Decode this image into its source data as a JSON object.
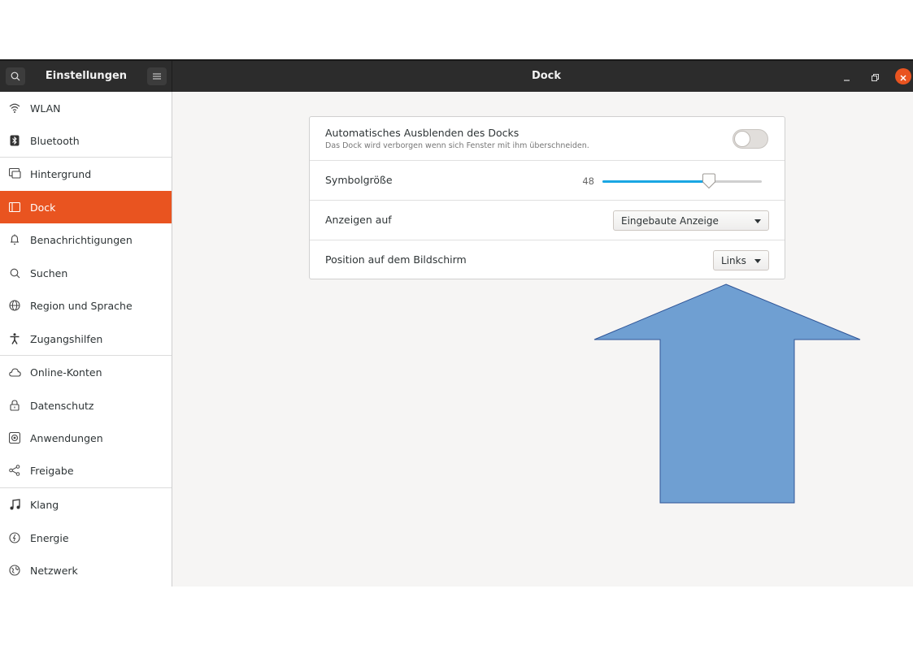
{
  "titlebar": {
    "app_title": "Einstellungen",
    "panel_title": "Dock",
    "icons": {
      "search": "search-icon",
      "menu": "hamburger-menu-icon",
      "minimize": "minimize-icon",
      "restore": "restore-icon",
      "close": "close-icon"
    }
  },
  "sidebar": {
    "items": [
      {
        "label": "WLAN",
        "icon": "wifi-icon"
      },
      {
        "label": "Bluetooth",
        "icon": "bluetooth-icon"
      },
      {
        "label": "Hintergrund",
        "icon": "background-icon"
      },
      {
        "label": "Dock",
        "icon": "dock-icon",
        "active": true
      },
      {
        "label": "Benachrichtigungen",
        "icon": "bell-icon"
      },
      {
        "label": "Suchen",
        "icon": "search-icon"
      },
      {
        "label": "Region und Sprache",
        "icon": "globe-icon"
      },
      {
        "label": "Zugangshilfen",
        "icon": "accessibility-icon"
      },
      {
        "label": "Online-Konten",
        "icon": "cloud-icon"
      },
      {
        "label": "Datenschutz",
        "icon": "lock-icon"
      },
      {
        "label": "Anwendungen",
        "icon": "applications-icon"
      },
      {
        "label": "Freigabe",
        "icon": "share-icon"
      },
      {
        "label": "Klang",
        "icon": "music-note-icon"
      },
      {
        "label": "Energie",
        "icon": "power-icon"
      },
      {
        "label": "Netzwerk",
        "icon": "network-icon"
      }
    ]
  },
  "dock_settings": {
    "autohide": {
      "label": "Automatisches Ausblenden des Docks",
      "description": "Das Dock wird verborgen wenn sich Fenster mit ihm überschneiden.",
      "enabled": false
    },
    "icon_size": {
      "label": "Symbolgröße",
      "value": "48",
      "fraction": 0.67
    },
    "display": {
      "label": "Anzeigen auf",
      "selected": "Eingebaute Anzeige"
    },
    "position": {
      "label": "Position auf dem Bildschirm",
      "selected": "Links"
    }
  },
  "annotation": {
    "shape": "up-arrow",
    "fill": "#6f9fd2",
    "stroke": "#2f5597"
  },
  "colors": {
    "accent": "#e95420",
    "slider": "#19a6e3",
    "titlebar": "#2c2c2c"
  }
}
